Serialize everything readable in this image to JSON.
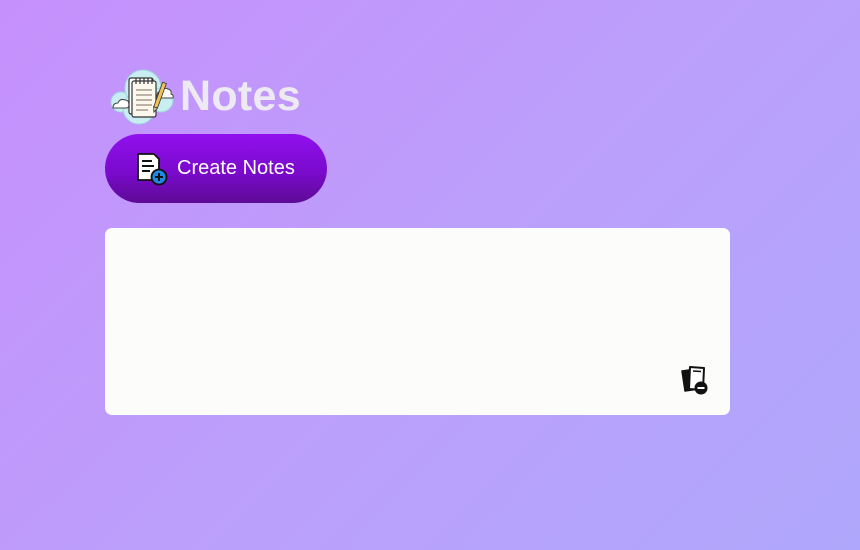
{
  "app": {
    "title": "Notes",
    "logo_icon": "notepad-cloud-icon"
  },
  "toolbar": {
    "create_label": "Create Notes",
    "create_icon": "document-add-icon"
  },
  "notes": [
    {
      "text": "",
      "delete_icon": "delete-note-icon"
    }
  ],
  "colors": {
    "background_start": "#c690fc",
    "background_end": "#afa7fb",
    "title": "#eeeaf3",
    "button_start": "#9110ee",
    "button_end": "#5e0a96",
    "card": "#fcfcfb"
  }
}
